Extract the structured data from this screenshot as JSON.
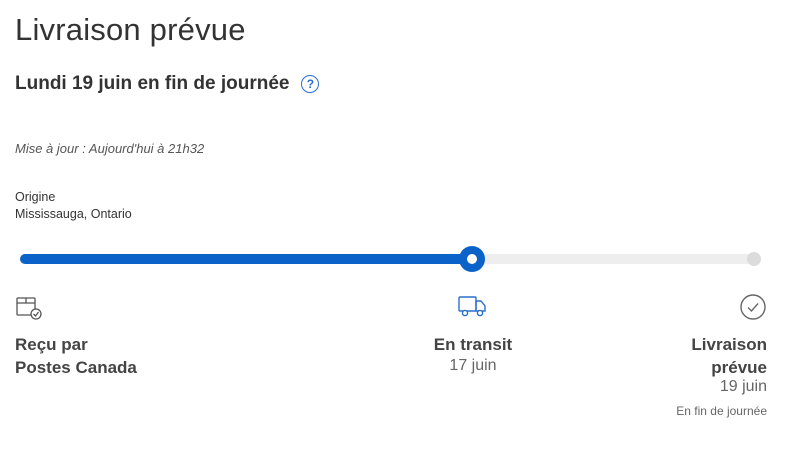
{
  "header": {
    "title": "Livraison prévue",
    "delivery_date": "Lundi 19 juin en fin de journée",
    "help_icon": "question-circle-icon",
    "updated": "Mise à jour : Aujourd'hui à 21h32"
  },
  "origin": {
    "label": "Origine",
    "value": "Mississauga, Ontario"
  },
  "progress": {
    "fraction": 0.61,
    "fill_color": "#0b63c9",
    "track_color": "#eeeeee"
  },
  "steps": [
    {
      "icon": "package-received-icon",
      "label_line1": "Reçu par",
      "label_line2": "Postes Canada"
    },
    {
      "icon": "delivery-truck-icon",
      "label": "En transit",
      "date": "17 juin"
    },
    {
      "icon": "check-circle-icon",
      "label_line1": "Livraison",
      "label_line2": "prévue",
      "date": "19 juin",
      "note": "En fin de journée"
    }
  ]
}
